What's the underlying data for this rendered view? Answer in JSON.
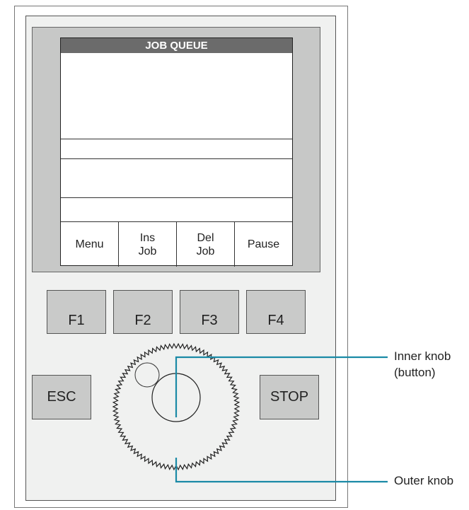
{
  "screen": {
    "title": "JOB QUEUE",
    "softkeys": [
      {
        "label": "Menu"
      },
      {
        "label": "Ins\nJob"
      },
      {
        "label": "Del\nJob"
      },
      {
        "label": "Pause"
      }
    ]
  },
  "function_keys": [
    "F1",
    "F2",
    "F3",
    "F4"
  ],
  "side_buttons": {
    "esc": "ESC",
    "stop": "STOP"
  },
  "callouts": {
    "inner_knob_line1": "Inner knob",
    "inner_knob_line2": "(button)",
    "outer_knob": "Outer knob"
  },
  "colors": {
    "callout_line": "#1a8aa6",
    "title_bar": "#6b6b6b",
    "button": "#c9cac9"
  }
}
